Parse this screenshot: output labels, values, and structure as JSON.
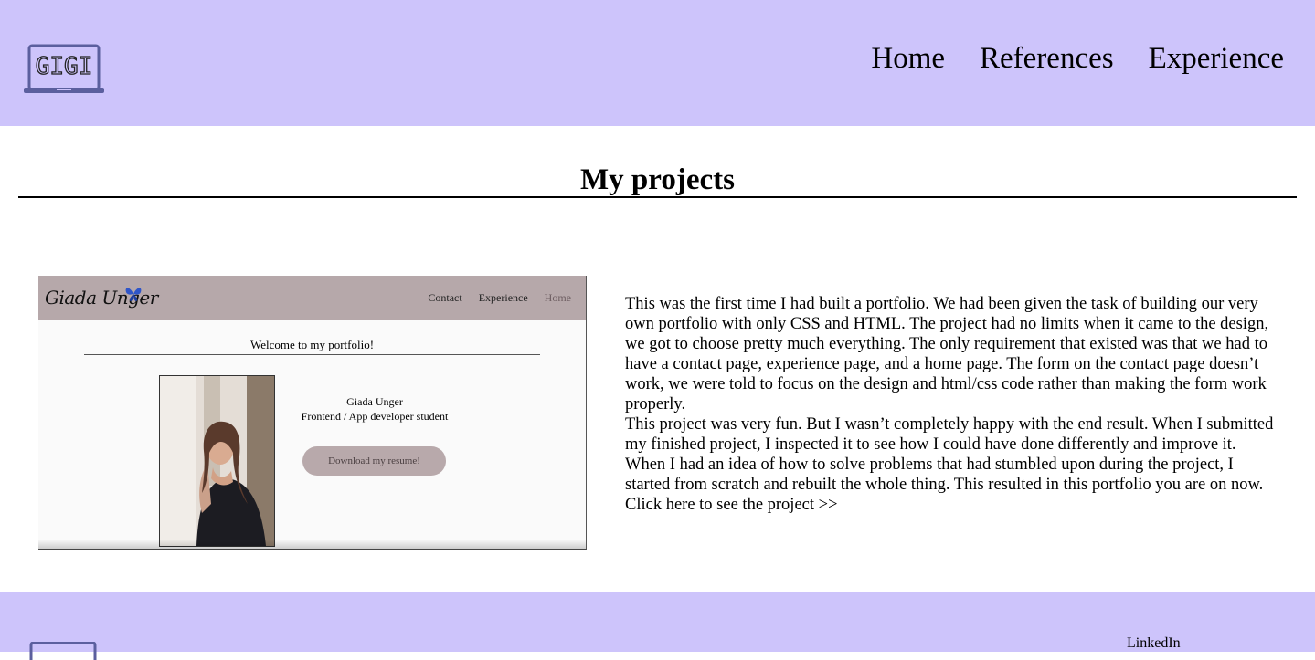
{
  "header": {
    "logo_text": "GIGI",
    "nav": [
      {
        "label": "Home"
      },
      {
        "label": "References"
      },
      {
        "label": "Experience"
      }
    ]
  },
  "main": {
    "title": "My projects",
    "project": {
      "thumbnail": {
        "site_name": "Giada Unger",
        "nav": [
          "Contact",
          "Experience",
          "Home"
        ],
        "welcome": "Welcome to my portfolio!",
        "person_name": "Giada Unger",
        "role": "Frontend / App developer student",
        "button_label": "Download my resume!"
      },
      "paragraphs": [
        "This was the first time I had built a portfolio. We had been given the task of building our very own portfolio with only CSS and HTML. The project had no limits when it came to the design, we got to choose pretty much everything. The only requirement that existed was that we had to have a contact page, experience page, and a home page. The form on the contact page doesn’t work, we were told to focus on the design and html/css code rather than making the form work properly.",
        "This project was very fun. But I wasn’t completely happy with the end result. When I submitted my finished project, I inspected it to see how I could have done differently and improve it. When I had an idea of how to solve problems that had stumbled upon during the project, I started from scratch and rebuilt the whole thing. This resulted in this portfolio you are on now."
      ],
      "link_label": "Click here to see the project >>"
    }
  },
  "footer": {
    "linkedin_label": "LinkedIn"
  },
  "colors": {
    "header_bg": "#cdc4fb",
    "logo_stroke": "#5b5f9e"
  }
}
